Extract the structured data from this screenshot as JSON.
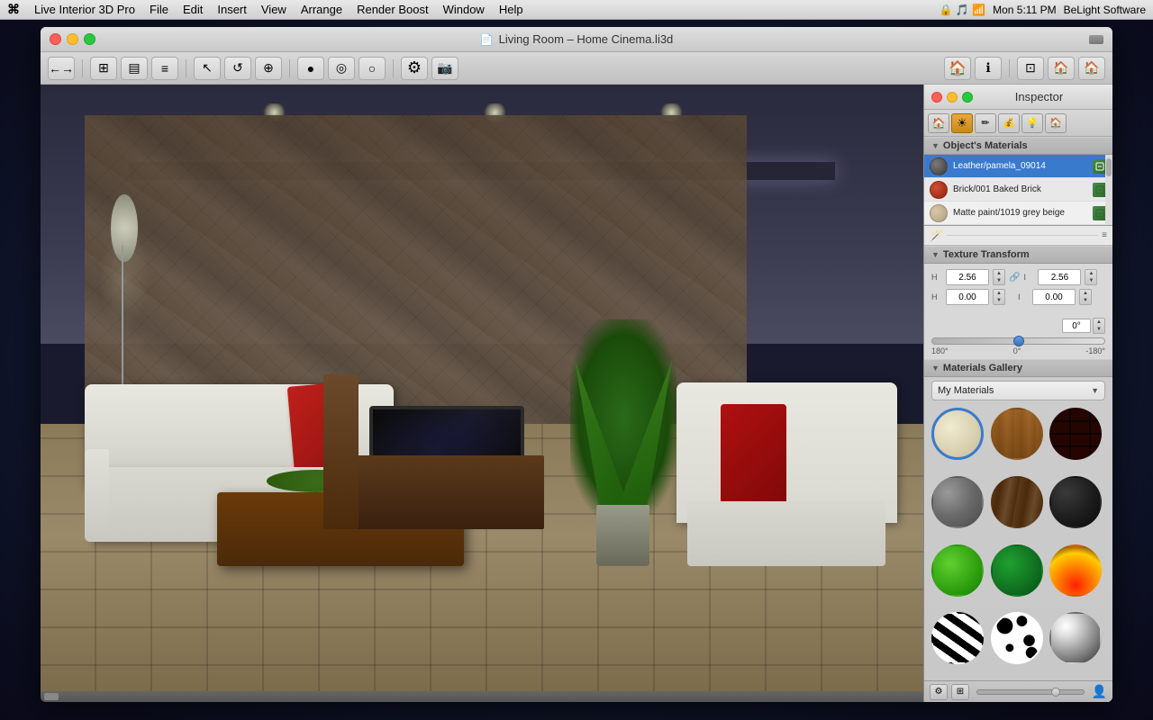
{
  "menubar": {
    "apple": "⌘",
    "items": [
      "Live Interior 3D Pro",
      "File",
      "Edit",
      "Insert",
      "View",
      "Arrange",
      "Render Boost",
      "Window",
      "Help"
    ],
    "right": {
      "clock": "Mon 5:11 PM",
      "company": "BeLight Software"
    }
  },
  "window": {
    "title": "Living Room – Home Cinema.li3d",
    "controls": {
      "red": "",
      "yellow": "",
      "green": ""
    }
  },
  "toolbar": {
    "buttons": [
      "←→",
      "⊞",
      "▤",
      "≡",
      "↖",
      "↺",
      "⊕",
      "●",
      "◎",
      "○",
      "⚙",
      "📷",
      "🏠",
      "ℹ",
      "⊡",
      "🏠",
      "🏠"
    ]
  },
  "inspector": {
    "title": "Inspector",
    "tabs": [
      "🏠",
      "☀",
      "✏",
      "💰",
      "💡",
      "🏠"
    ],
    "objects_materials": {
      "label": "Object's Materials",
      "items": [
        {
          "name": "Leather/pamela_09014",
          "swatch_color": "#5a5a5a",
          "selected": true
        },
        {
          "name": "Brick/001 Baked Brick",
          "swatch_color": "#c0401a",
          "selected": false
        },
        {
          "name": "Matte paint/1019 grey beige",
          "swatch_color": "#c8b89a",
          "selected": false
        }
      ]
    },
    "texture_transform": {
      "label": "Texture Transform",
      "width_x": "2.56",
      "width_y": "2.56",
      "offset_x": "0.00",
      "offset_y": "0.00",
      "angle": "0°",
      "angle_min": "180°",
      "angle_zero": "0°",
      "angle_max": "-180°"
    },
    "materials_gallery": {
      "label": "Materials Gallery",
      "dropdown": "My Materials",
      "items": [
        {
          "id": "cream",
          "class": "mat-cream"
        },
        {
          "id": "wood-light",
          "class": "mat-wood-light"
        },
        {
          "id": "brick",
          "class": "mat-brick"
        },
        {
          "id": "stone",
          "class": "mat-stone"
        },
        {
          "id": "wood-dark",
          "class": "mat-wood-dark"
        },
        {
          "id": "black",
          "class": "mat-black"
        },
        {
          "id": "green-bright",
          "class": "mat-green-bright"
        },
        {
          "id": "green-dark",
          "class": "mat-green-dark"
        },
        {
          "id": "fire",
          "class": "mat-fire"
        },
        {
          "id": "zebra",
          "class": "mat-zebra"
        },
        {
          "id": "dalmatian",
          "class": "mat-dalmatian"
        },
        {
          "id": "chrome",
          "class": "mat-chrome"
        }
      ]
    }
  }
}
